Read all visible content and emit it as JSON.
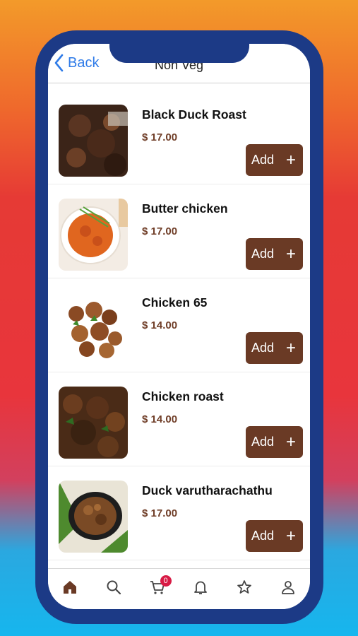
{
  "header": {
    "back_label": "Back",
    "title": "Non Veg"
  },
  "items": [
    {
      "name": "Black Duck Roast",
      "price": "$ 17.00",
      "add_label": "Add",
      "add_icon": "+"
    },
    {
      "name": "Butter chicken",
      "price": "$ 17.00",
      "add_label": "Add",
      "add_icon": "+"
    },
    {
      "name": "Chicken 65",
      "price": "$ 14.00",
      "add_label": "Add",
      "add_icon": "+"
    },
    {
      "name": "Chicken roast",
      "price": "$ 14.00",
      "add_label": "Add",
      "add_icon": "+"
    },
    {
      "name": "Duck varutharachathu",
      "price": "$ 17.00",
      "add_label": "Add",
      "add_icon": "+"
    }
  ],
  "tabbar": {
    "icons": [
      "home-icon",
      "search-icon",
      "cart-icon",
      "bell-icon",
      "star-icon",
      "user-icon"
    ],
    "cart_count": "0"
  },
  "colors": {
    "accent": "#6a3a25",
    "price": "#6f3d27",
    "back_link": "#2f7be8",
    "phone_frame": "#1c3a86",
    "badge": "#d81b45"
  }
}
